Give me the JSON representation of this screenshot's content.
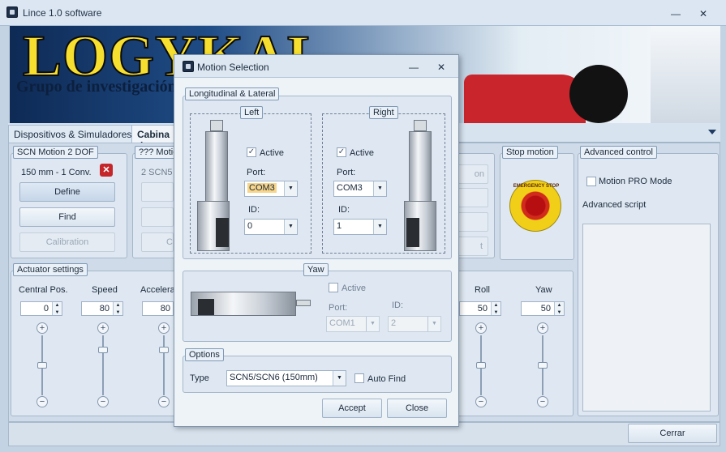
{
  "window": {
    "title": "Lince 1.0 software"
  },
  "banner": {
    "logo": "LOGYKAL",
    "subtitle": "Grupo de investigación"
  },
  "tabs": [
    {
      "label": "Dispositivos & Simuladores"
    },
    {
      "label": "Cabina d"
    }
  ],
  "scn_group": {
    "title": "SCN Motion 2 DOF",
    "info": "150 mm - 1 Conv.",
    "define": "Define",
    "find": "Find",
    "calibration": "Calibration"
  },
  "second_group": {
    "title": "??? Motio",
    "info": "2 SCN5",
    "calib_fragment": "C"
  },
  "right_fragments": {
    "a": "on",
    "b": "t"
  },
  "stop_group": {
    "title": "Stop motion",
    "estop_text": "EMERGENCY STOP"
  },
  "advanced": {
    "title": "Advanced control",
    "pro_mode": "Motion PRO Mode",
    "script_label": "Advanced script"
  },
  "actuator_settings": {
    "title": "Actuator settings",
    "columns": [
      {
        "label": "Central Pos.",
        "value": "0"
      },
      {
        "label": "Speed",
        "value": "80"
      },
      {
        "label": "Accelera",
        "value": "80"
      },
      {
        "label": "Roll",
        "value": "50"
      },
      {
        "label": "Yaw",
        "value": "50"
      }
    ]
  },
  "footer": {
    "close": "Cerrar"
  },
  "dialog": {
    "title": "Motion Selection",
    "longlat": {
      "title": "Longitudinal & Lateral"
    },
    "left": {
      "title": "Left",
      "active": "Active",
      "port_label": "Port:",
      "port": "COM3",
      "id_label": "ID:",
      "id": "0"
    },
    "right": {
      "title": "Right",
      "active": "Active",
      "port_label": "Port:",
      "port": "COM3",
      "id_label": "ID:",
      "id": "1"
    },
    "yaw": {
      "title": "Yaw",
      "active": "Active",
      "port_label": "Port:",
      "port": "COM1",
      "id_label": "ID:",
      "id": "2"
    },
    "options": {
      "title": "Options",
      "type_label": "Type",
      "type": "SCN5/SCN6 (150mm)",
      "autofind": "Auto Find"
    },
    "accept": "Accept",
    "close": "Close"
  },
  "icons": {
    "app": "app-icon",
    "minimize": "minimize-icon",
    "close": "close-icon"
  }
}
